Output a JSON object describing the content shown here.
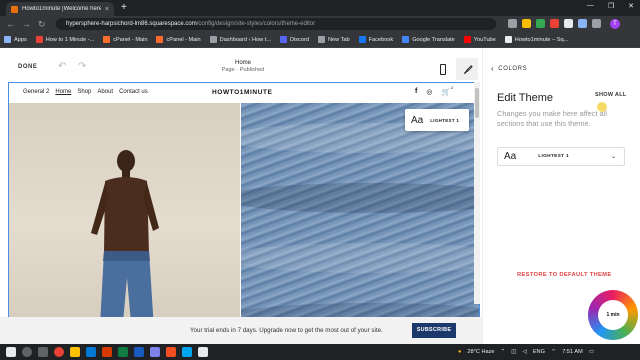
{
  "browser": {
    "tab_title": "Howto1minute |Welcome here",
    "tab_close": "×",
    "new_tab": "+",
    "window_controls": [
      "—",
      "❐",
      "✕"
    ],
    "url_domain": "hypersphere-harpsichord-lm86.squarespace.com",
    "url_path": "/config/design/site-styles/colors/theme-editor",
    "avatar_letter": "T",
    "bookmarks": [
      {
        "label": "Apps",
        "color": "#8ab4f8"
      },
      {
        "label": "How to 1 Minute -...",
        "color": "#ea4335"
      },
      {
        "label": "cPanel - Main",
        "color": "#ff6c2c"
      },
      {
        "label": "cPanel - Main",
        "color": "#ff6c2c"
      },
      {
        "label": "Dashboard ‹ How t...",
        "color": "#9aa0a6"
      },
      {
        "label": "Discord",
        "color": "#5865f2"
      },
      {
        "label": "New Tab",
        "color": "#9aa0a6"
      },
      {
        "label": "Facebook",
        "color": "#1877f2"
      },
      {
        "label": "Google Translate",
        "color": "#4285f4"
      },
      {
        "label": "YouTube",
        "color": "#ff0000"
      },
      {
        "label": "Howto1minute – Sq...",
        "color": "#e8eaed"
      }
    ]
  },
  "editor": {
    "done_label": "DONE",
    "page_name": "Home",
    "page_status": "Page · Published"
  },
  "site": {
    "nav_links": [
      "General 2",
      "Home",
      "Shop",
      "About",
      "Contact us"
    ],
    "logo": "HOWTO1MINUTE",
    "cart_count": "2",
    "theme_badge_aa": "Aa",
    "theme_badge_label": "LIGHTEST 1"
  },
  "panel": {
    "back_label": "COLORS",
    "title": "Edit Theme",
    "show_all": "SHOW ALL",
    "description": "Changes you make here affect all sections that use this theme.",
    "select_aa": "Aa",
    "select_value": "LIGHTEST 1",
    "restore_label": "RESTORE TO DEFAULT THEME",
    "restore_color": "#e04343"
  },
  "trial": {
    "text": "Your trial ends in 7 days. Upgrade now to get the most out of your site.",
    "subscribe_label": "SUBSCRIBE",
    "subscribe_color": "#1b3a6b"
  },
  "logo_badge": {
    "text": "1 min"
  },
  "taskbar": {
    "weather": "28°C Haze",
    "language": "ENG",
    "time": "7:51 AM"
  }
}
